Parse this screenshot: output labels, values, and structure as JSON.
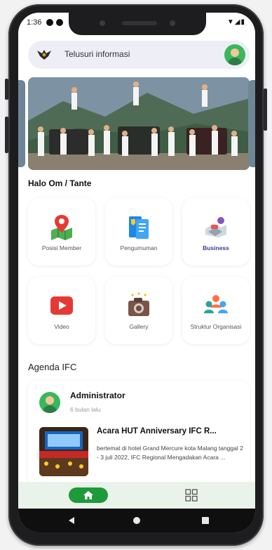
{
  "status": {
    "time": "1:36",
    "icons": "▼◢▮"
  },
  "header": {
    "search_placeholder": "Telusuri informasi"
  },
  "greeting": "Halo Om / Tante",
  "menu": [
    {
      "label": "Posisi Member",
      "icon": "map-pin-icon"
    },
    {
      "label": "Pengumuman",
      "icon": "announcement-icon"
    },
    {
      "label": "Business",
      "icon": "business-icon"
    },
    {
      "label": "Video",
      "icon": "video-play-icon"
    },
    {
      "label": "Gallery",
      "icon": "camera-icon"
    },
    {
      "label": "Struktur Organisasi",
      "icon": "people-group-icon"
    }
  ],
  "agenda": {
    "section_title": "Agenda IFC",
    "author": "Administrator",
    "time": "6 bulan lalu",
    "title": "Acara HUT Anniversary IFC R...",
    "description": "bertemat di hotel Grand Mercure kota Malang tanggal 2 - 3 juli 2022, IFC Regional Mengadakan Acara ..."
  },
  "colors": {
    "accent": "#1e9a3a",
    "nav_bg": "#e9f3ea",
    "search_bg": "#eeeef6"
  }
}
